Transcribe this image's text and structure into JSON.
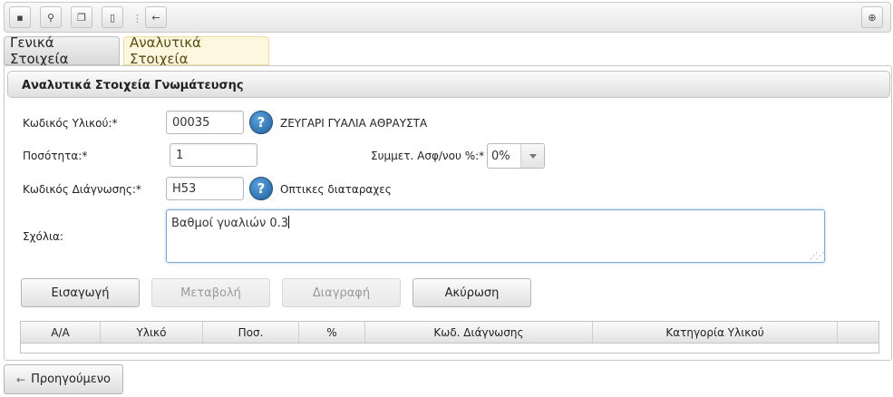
{
  "toolbar": {
    "buttons": [
      {
        "name": "save-icon",
        "glyph": "▪"
      },
      {
        "name": "search-icon",
        "glyph": "⚲"
      },
      {
        "name": "copy-icon",
        "glyph": "❐"
      },
      {
        "name": "new-document-icon",
        "glyph": "▯"
      },
      {
        "name": "back-arrow-icon",
        "glyph": "←"
      }
    ],
    "add_icon": "⊕"
  },
  "tabs": {
    "general": "Γενικά Στοιχεία",
    "details": "Αναλυτικά Στοιχεία"
  },
  "section": {
    "title": "Αναλυτικά Στοιχεία Γνωμάτευσης"
  },
  "form": {
    "material_code_label": "Κωδικός Υλικού:*",
    "material_code_value": "00035",
    "material_desc": "ΖΕΥΓΑΡΙ ΓΥΑΛΙΑ ΑΘΡΑΥΣΤΑ",
    "quantity_label": "Ποσότητα:*",
    "quantity_value": "1",
    "copay_label": "Συμμετ. Ασφ/νου %:*",
    "copay_value": "0%",
    "diagnosis_label": "Κωδικός Διάγνωσης:*",
    "diagnosis_value": "H53",
    "diagnosis_desc": "Οπτικες διαταραχες",
    "comments_label": "Σχόλια:",
    "comments_value": "Βαθμοί γυαλιών 0.3",
    "help_glyph": "?"
  },
  "actions": {
    "insert": "Εισαγωγή",
    "modify": "Μεταβολή",
    "delete": "Διαγραφή",
    "cancel": "Ακύρωση"
  },
  "table": {
    "columns": [
      "Α/Α",
      "Υλικό",
      "Ποσ.",
      "%",
      "Κωδ. Διάγνωσης",
      "Κατηγορία Υλικού"
    ]
  },
  "footer": {
    "prev_label": "Προηγούμενο",
    "prev_arrow": "←"
  }
}
